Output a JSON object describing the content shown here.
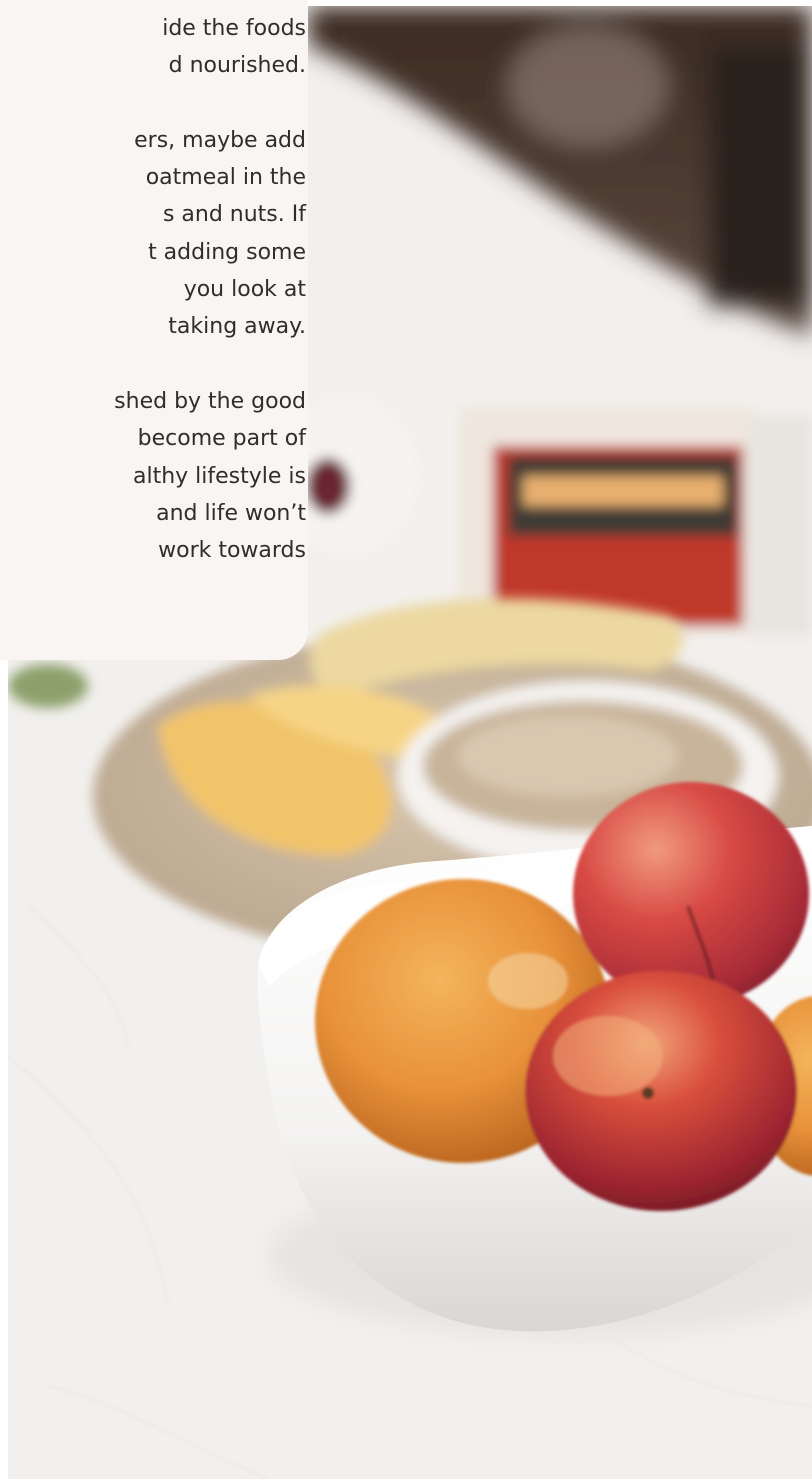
{
  "article": {
    "paragraphs": [
      {
        "lines": [
          "ide the foods",
          "d nourished."
        ]
      },
      {
        "lines": [
          "ers, maybe add",
          "oatmeal in the",
          "s and nuts. If",
          "t adding some",
          "you look at",
          "taking away."
        ]
      },
      {
        "lines": [
          "shed by the good",
          "become part of",
          "althy lifestyle is",
          "and life won’t",
          "work towards"
        ]
      }
    ]
  },
  "photo": {
    "subject": "bowl-of-fruit",
    "colors": {
      "card_background": "#f9f5f2",
      "text": "#2e2e2e",
      "countertop": "#f3f2f0"
    }
  }
}
